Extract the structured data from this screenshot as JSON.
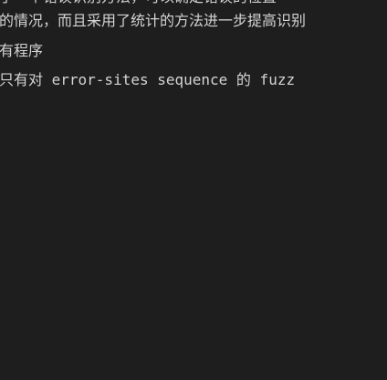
{
  "editor": {
    "lines": [
      "的情况，而且采用了统计的方法进一步提高识别",
      "有程序",
      "只有对 error-sites sequence 的 fuzz"
    ],
    "partial_top_line": "了一个错误识别方法，可以确定错误的位置"
  }
}
